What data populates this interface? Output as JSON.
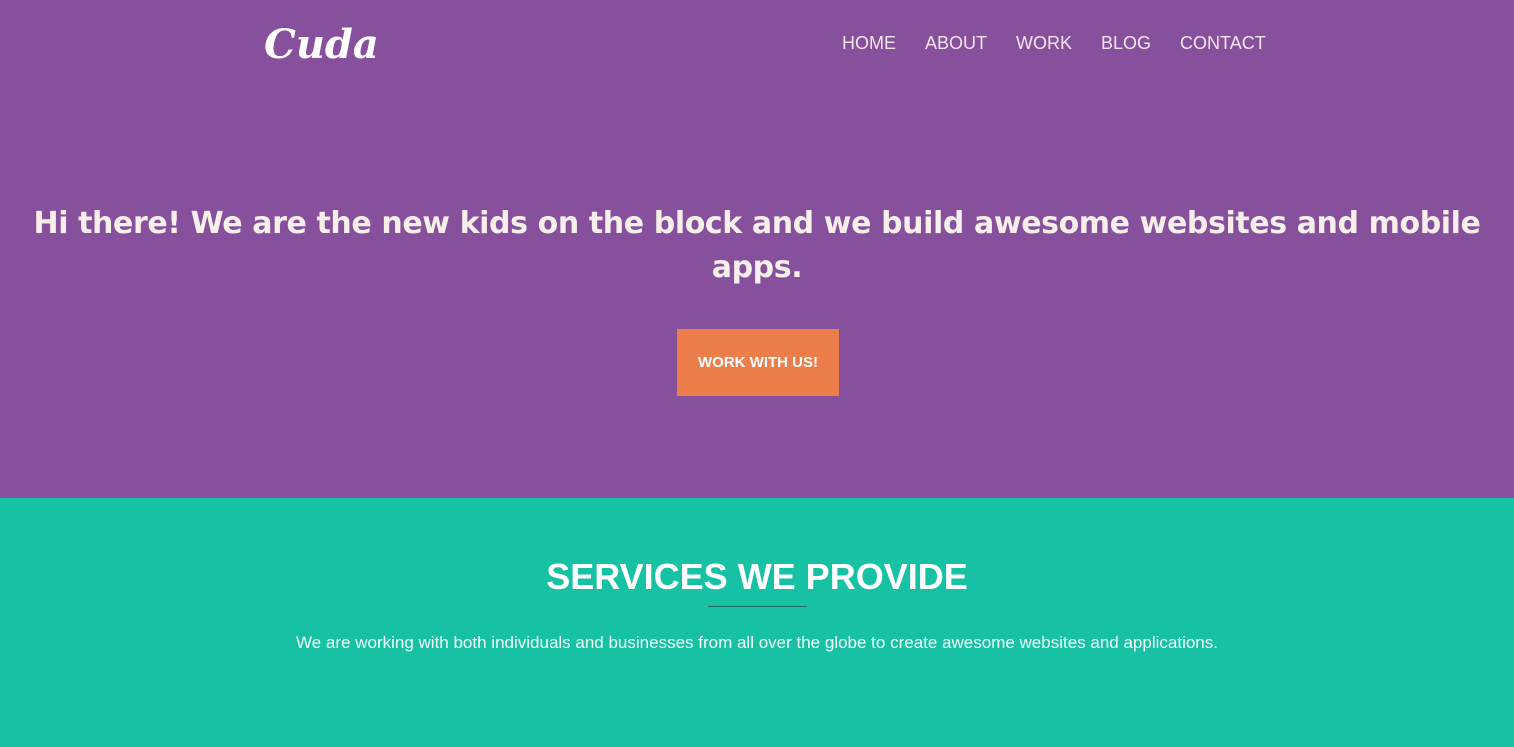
{
  "header": {
    "logo": "Cuda",
    "nav": [
      {
        "label": "HOME"
      },
      {
        "label": "ABOUT"
      },
      {
        "label": "WORK"
      },
      {
        "label": "BLOG"
      },
      {
        "label": "CONTACT"
      }
    ]
  },
  "hero": {
    "title": "Hi there! We are the new kids on the block and we build awesome websites and mobile apps.",
    "cta_label": "WORK WITH US!"
  },
  "services": {
    "title": "SERVICES WE PROVIDE",
    "description": "We are working with both individuals and businesses from all over the globe to create awesome websites and applications."
  },
  "colors": {
    "hero_background": "#87509c",
    "cta_background": "#ec7e4b",
    "services_background": "#17c1a4"
  }
}
